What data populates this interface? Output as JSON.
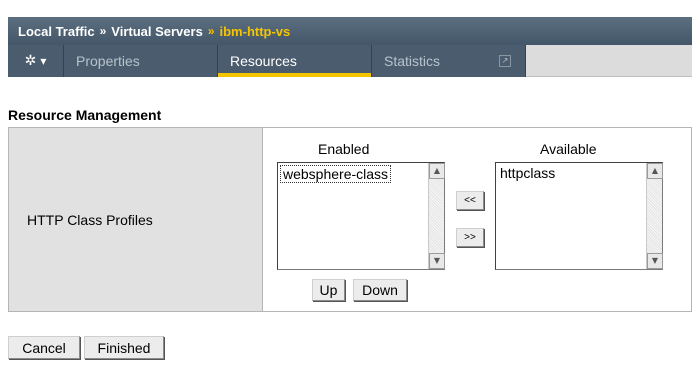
{
  "breadcrumb": {
    "items": [
      "Local Traffic",
      "Virtual Servers",
      "ibm-http-vs"
    ],
    "separator": "»"
  },
  "tabs": {
    "menu_icon": "gear-icon",
    "menu_caret": "▾",
    "items": [
      {
        "label": "Properties",
        "active": false
      },
      {
        "label": "Resources",
        "active": true
      },
      {
        "label": "Statistics",
        "active": false
      }
    ],
    "statistics_popout_icon": "external-link-icon"
  },
  "section": {
    "title": "Resource Management"
  },
  "http_class_profiles": {
    "label": "HTTP Class Profiles",
    "enabled_header": "Enabled",
    "available_header": "Available",
    "enabled_items": [
      "websphere-class"
    ],
    "available_items": [
      "httpclass"
    ],
    "move_left_label": "<<",
    "move_right_label": ">>",
    "up_label": "Up",
    "down_label": "Down"
  },
  "actions": {
    "cancel_label": "Cancel",
    "finished_label": "Finished"
  },
  "colors": {
    "header_bg": "#4a5c6d",
    "accent": "#f5c400",
    "label_cell_bg": "#e1e1e1"
  }
}
